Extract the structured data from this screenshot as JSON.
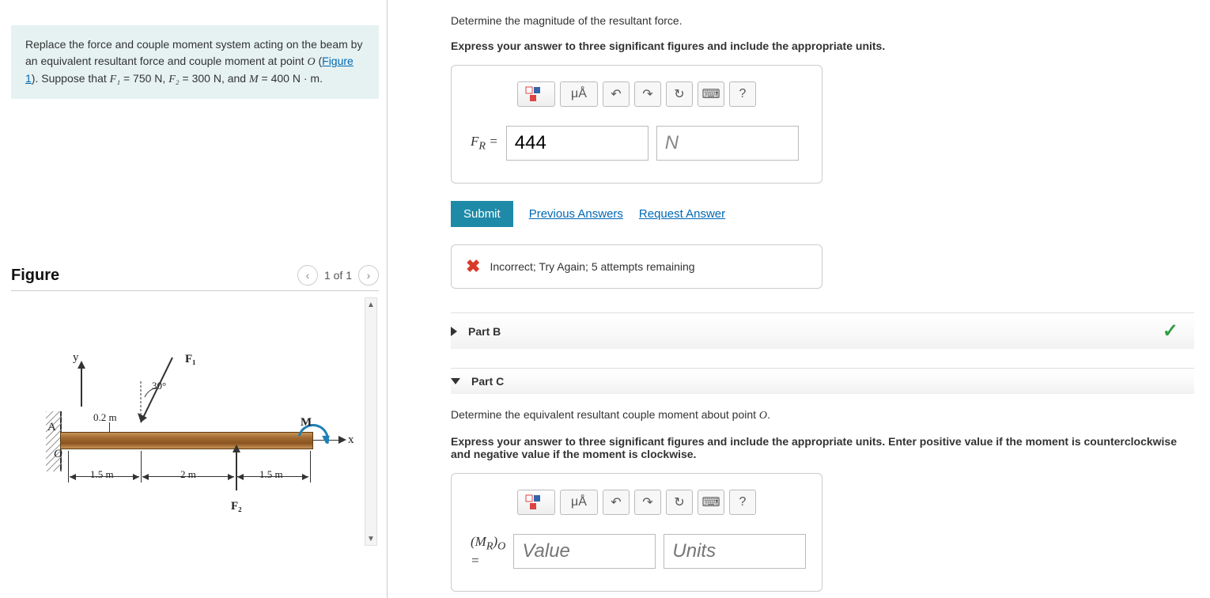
{
  "problem": {
    "text_before_link": "Replace the force and couple moment system acting on the beam by an equivalent resultant force and couple moment at point ",
    "point_O": "O",
    "link_label": "Figure 1",
    "text_after_link": ". Suppose that ",
    "F1_label": "F₁",
    "F1_value": " = 750 N",
    "F2_label": "F₂",
    "F2_value": " = 300 N",
    "M_label": "M",
    "M_value": " = 400 N · m",
    "comma": ", ",
    "and": ", and ",
    "period": "."
  },
  "figure": {
    "title": "Figure",
    "pager": "1 of 1",
    "labels": {
      "y": "y",
      "x": "x",
      "A": "A",
      "O": "O",
      "F1": "F₁",
      "F2": "F₂",
      "M": "M",
      "angle": "30°",
      "d1": "0.2 m",
      "d2": "1.5 m",
      "d3": "2 m",
      "d4": "1.5 m"
    }
  },
  "partA": {
    "question": "Determine the magnitude of the resultant force.",
    "instruction": "Express your answer to three significant figures and include the appropriate units.",
    "eq_label": "F_R =",
    "eq_label_html": "F",
    "eq_sub": "R",
    "value": "444",
    "units": "N",
    "submit": "Submit",
    "prev_answers": "Previous Answers",
    "request_answer": "Request Answer",
    "feedback": "Incorrect; Try Again; 5 attempts remaining",
    "toolbar": {
      "units_btn": "μÅ",
      "help": "?"
    }
  },
  "partB": {
    "title": "Part B"
  },
  "partC": {
    "title": "Part C",
    "question_before": "Determine the equivalent resultant couple moment about point ",
    "question_O": "O",
    "question_after": ".",
    "instruction": "Express your answer to three significant figures and include the appropriate units. Enter positive value if the moment is counterclockwise and negative value if the moment is clockwise.",
    "eq_main": "M",
    "eq_sub1": "R",
    "eq_sub2": "O",
    "value_placeholder": "Value",
    "units_placeholder": "Units",
    "toolbar": {
      "units_btn": "μÅ",
      "help": "?"
    }
  }
}
